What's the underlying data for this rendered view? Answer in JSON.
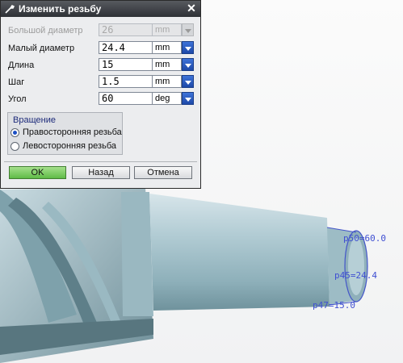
{
  "dialog": {
    "title": "Изменить резьбу",
    "fields": [
      {
        "label": "Большой диаметр",
        "value": "26",
        "unit": "mm",
        "enabled": false
      },
      {
        "label": "Малый диаметр",
        "value": "24.4",
        "unit": "mm",
        "enabled": true
      },
      {
        "label": "Длина",
        "value": "15",
        "unit": "mm",
        "enabled": true
      },
      {
        "label": "Шаг",
        "value": "1.5",
        "unit": "mm",
        "enabled": true
      },
      {
        "label": "Угол",
        "value": "60",
        "unit": "deg",
        "enabled": true
      }
    ],
    "rotation": {
      "title": "Вращение",
      "options": [
        {
          "label": "Правосторонняя резьба",
          "selected": true
        },
        {
          "label": "Левосторонняя резьба",
          "selected": false
        }
      ]
    },
    "buttons": {
      "ok": "OK",
      "back": "Назад",
      "cancel": "Отмена"
    }
  },
  "viewport": {
    "dimension_labels": [
      "p50=60.0",
      "p45=24.4",
      "p47=15.0"
    ]
  },
  "colors": {
    "dimension_text": "#3f4fd2",
    "shaft": "#a8c4cc",
    "title_bar": "#3a3d42",
    "accent": "#1d48a8"
  }
}
